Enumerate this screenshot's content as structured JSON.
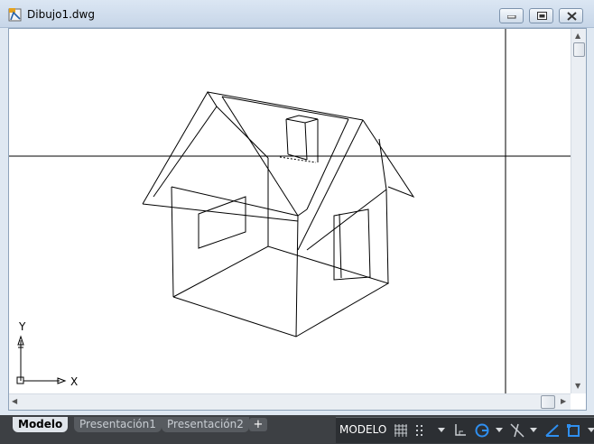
{
  "window": {
    "title": "Dibujo1.dwg",
    "icon": "autocad-drawing-icon",
    "controls": [
      "minimize-icon",
      "restore-icon",
      "close-icon"
    ]
  },
  "viewport": {
    "background": "#ffffff",
    "line_color": "#000000",
    "ucs": {
      "x_label": "X",
      "y_label": "Y"
    }
  },
  "layout_tabs": [
    {
      "label": "Modelo",
      "active": true
    },
    {
      "label": "Presentación1",
      "active": false
    },
    {
      "label": "Presentación2",
      "active": false
    }
  ],
  "add_tab": "+",
  "status_bar": {
    "mode_label": "MODELO",
    "icons": [
      "grid-icon",
      "ortho-icon",
      "polar-icon",
      "osnap-icon",
      "isodraft-icon",
      "lineweight-icon"
    ]
  }
}
